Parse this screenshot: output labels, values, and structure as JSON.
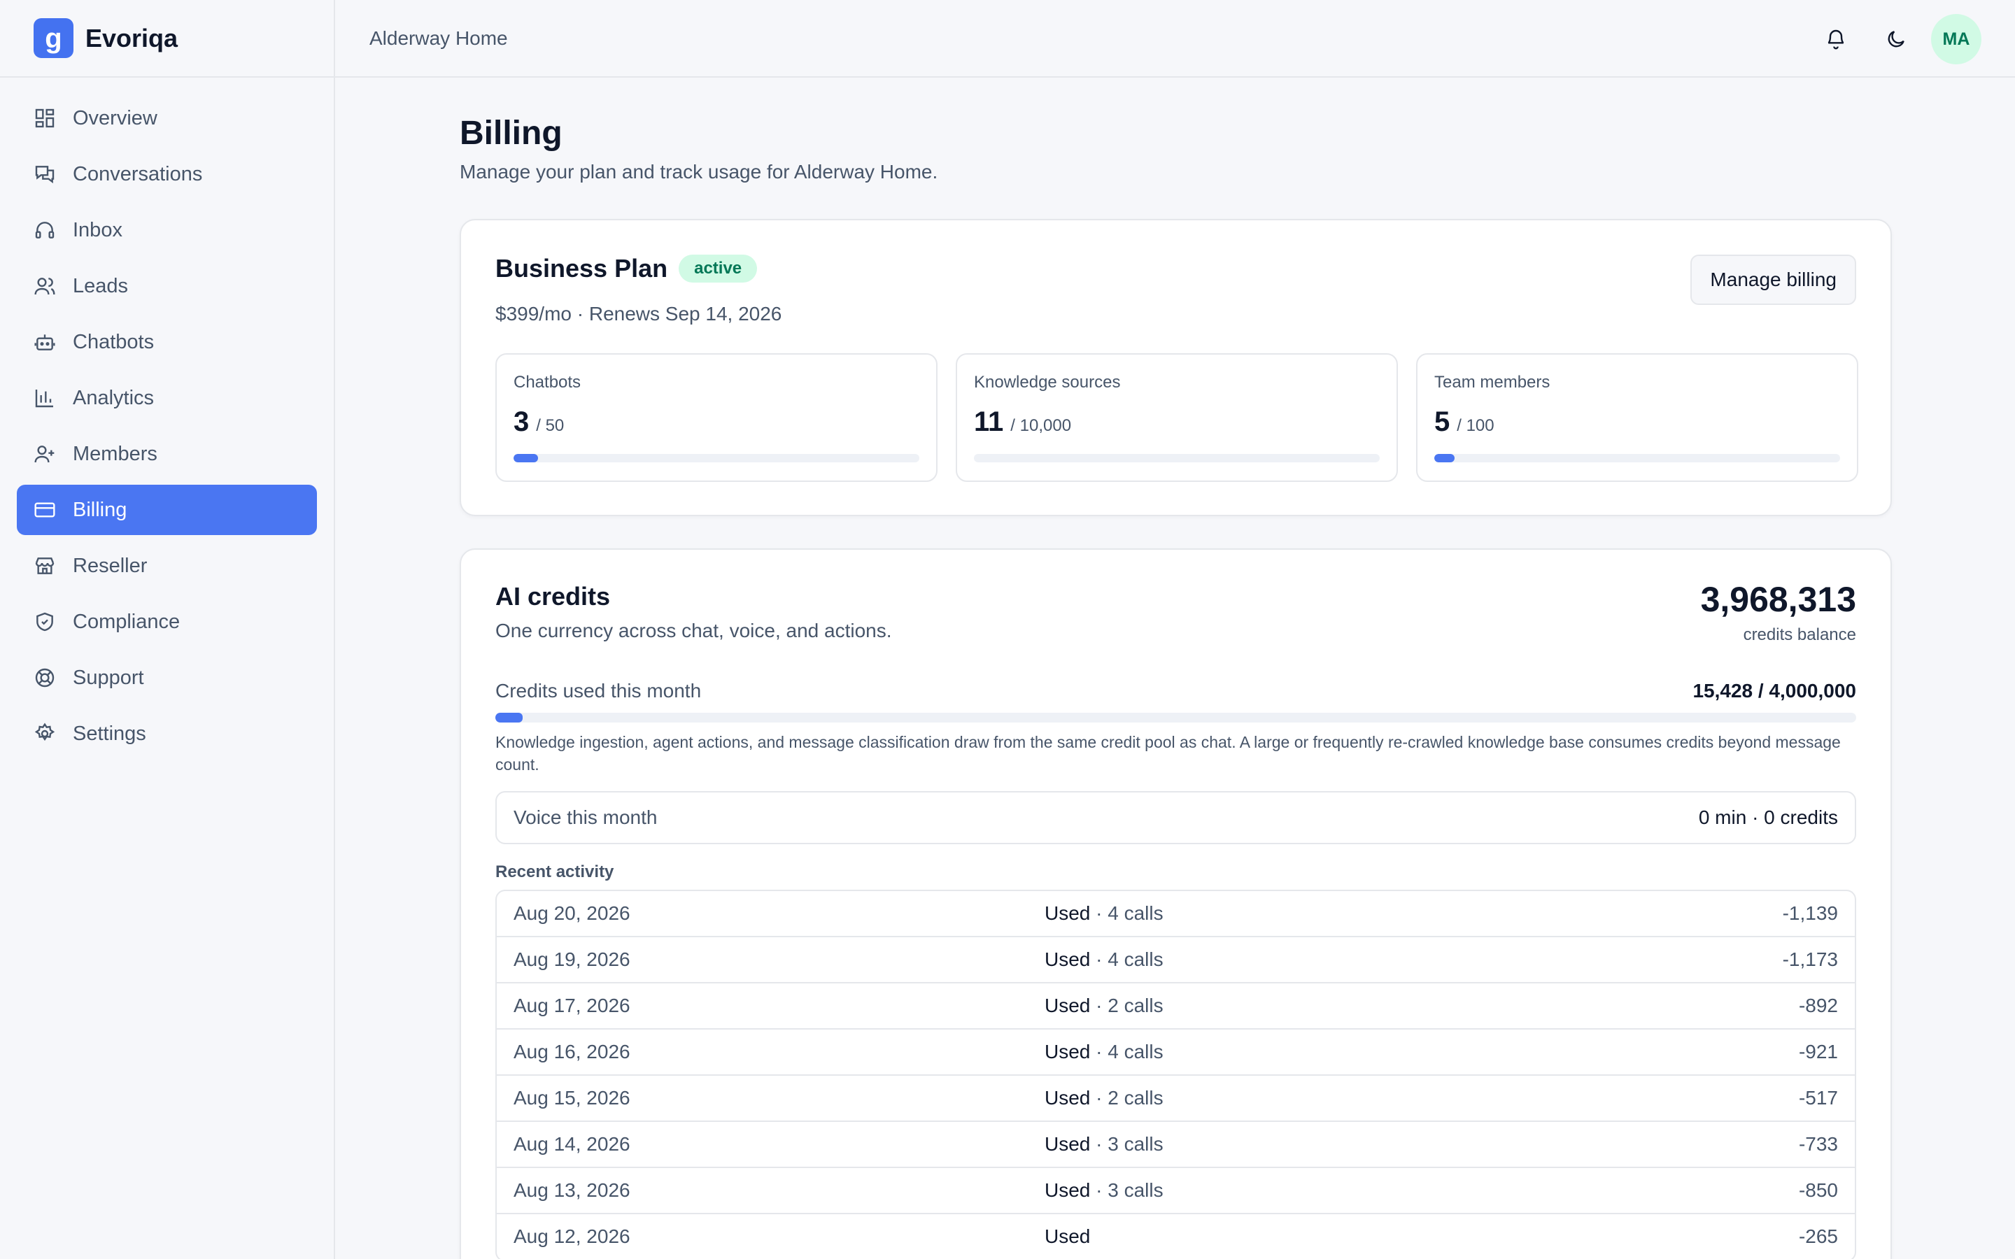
{
  "brand": {
    "name": "Evoriqa",
    "logo_glyph": "g"
  },
  "sidebar": {
    "items": [
      {
        "label": "Overview",
        "icon": "dashboard-icon"
      },
      {
        "label": "Conversations",
        "icon": "chat-icon"
      },
      {
        "label": "Inbox",
        "icon": "headset-icon"
      },
      {
        "label": "Leads",
        "icon": "users-icon"
      },
      {
        "label": "Chatbots",
        "icon": "bot-icon"
      },
      {
        "label": "Analytics",
        "icon": "bar-chart-icon"
      },
      {
        "label": "Members",
        "icon": "user-plus-icon"
      },
      {
        "label": "Billing",
        "icon": "credit-card-icon",
        "active": true
      },
      {
        "label": "Reseller",
        "icon": "store-icon"
      },
      {
        "label": "Compliance",
        "icon": "shield-icon"
      },
      {
        "label": "Support",
        "icon": "lifebuoy-icon"
      },
      {
        "label": "Settings",
        "icon": "gear-icon"
      }
    ]
  },
  "topbar": {
    "org_name": "Alderway Home",
    "avatar_initials": "MA"
  },
  "page": {
    "title": "Billing",
    "subtitle": "Manage your plan and track usage for Alderway Home."
  },
  "plan": {
    "name": "Business Plan",
    "status": "active",
    "meta": "$399/mo · Renews Sep 14, 2026",
    "manage_label": "Manage billing",
    "stats": [
      {
        "label": "Chatbots",
        "value": "3",
        "max": "/ 50",
        "fraction": 0.06
      },
      {
        "label": "Knowledge sources",
        "value": "11",
        "max": "/ 10,000",
        "fraction": 0.0011
      },
      {
        "label": "Team members",
        "value": "5",
        "max": "/ 100",
        "fraction": 0.05
      }
    ]
  },
  "credits": {
    "title": "AI credits",
    "subtitle": "One currency across chat, voice, and actions.",
    "balance": "3,968,313",
    "balance_label": "credits balance",
    "used_label": "Credits used this month",
    "used_value": "15,428 / 4,000,000",
    "used_fraction": 0.0039,
    "note": "Knowledge ingestion, agent actions, and message classification draw from the same credit pool as chat. A large or frequently re-crawled knowledge base consumes credits beyond message count.",
    "voice_label": "Voice this month",
    "voice_value": "0 min · 0 credits",
    "recent_label": "Recent activity",
    "activity": [
      {
        "date": "Aug 20, 2026",
        "kind": "Used",
        "detail": " · 4 calls",
        "amount": "-1,139"
      },
      {
        "date": "Aug 19, 2026",
        "kind": "Used",
        "detail": " · 4 calls",
        "amount": "-1,173"
      },
      {
        "date": "Aug 17, 2026",
        "kind": "Used",
        "detail": " · 2 calls",
        "amount": "-892"
      },
      {
        "date": "Aug 16, 2026",
        "kind": "Used",
        "detail": " · 4 calls",
        "amount": "-921"
      },
      {
        "date": "Aug 15, 2026",
        "kind": "Used",
        "detail": " · 2 calls",
        "amount": "-517"
      },
      {
        "date": "Aug 14, 2026",
        "kind": "Used",
        "detail": " · 3 calls",
        "amount": "-733"
      },
      {
        "date": "Aug 13, 2026",
        "kind": "Used",
        "detail": " · 3 calls",
        "amount": "-850"
      },
      {
        "date": "Aug 12, 2026",
        "kind": "Used",
        "detail": "",
        "amount": "-265"
      }
    ]
  },
  "colors": {
    "accent": "#4a76f2",
    "active_badge_bg": "#d1fae5",
    "active_badge_text": "#047857"
  }
}
